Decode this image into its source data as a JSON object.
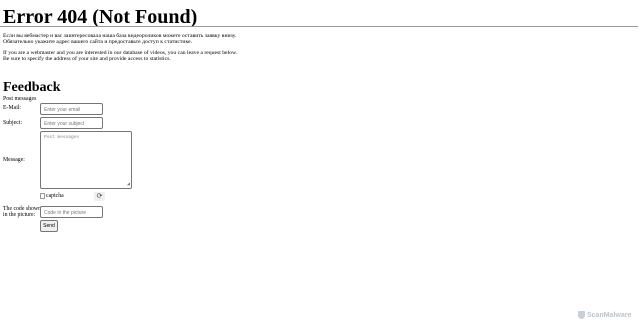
{
  "page": {
    "title": "Error 404 (Not Found)",
    "ru_line1": "Если вы вебмастер и вас заинтересовала наша база видеороликов можете оставить заявку внизу.",
    "ru_line2": "Обязательно укажите адрес вашего сайта и предоставьте доступ к статистике.",
    "en_line1": "If you are a webmaster and you are interested in our database of videos, you can leave a request below.",
    "en_line2": "Be sure to specify the address of your site and provide access to statistics."
  },
  "feedback": {
    "heading": "Feedback",
    "subheading": "Post messages",
    "email_label": "E-Mail:",
    "email_placeholder": "Enter your email",
    "subject_label": "Subject:",
    "subject_placeholder": "Enter your subject",
    "message_label": "Message:",
    "message_placeholder": "Post messages",
    "captcha_alt": "captcha",
    "refresh_icon": "refresh-icon",
    "code_label_1": "The code shown",
    "code_label_2": "in the picture:",
    "code_placeholder": "Code in the picture",
    "send_label": "Send"
  },
  "watermark": {
    "text": "ScanMalware"
  }
}
